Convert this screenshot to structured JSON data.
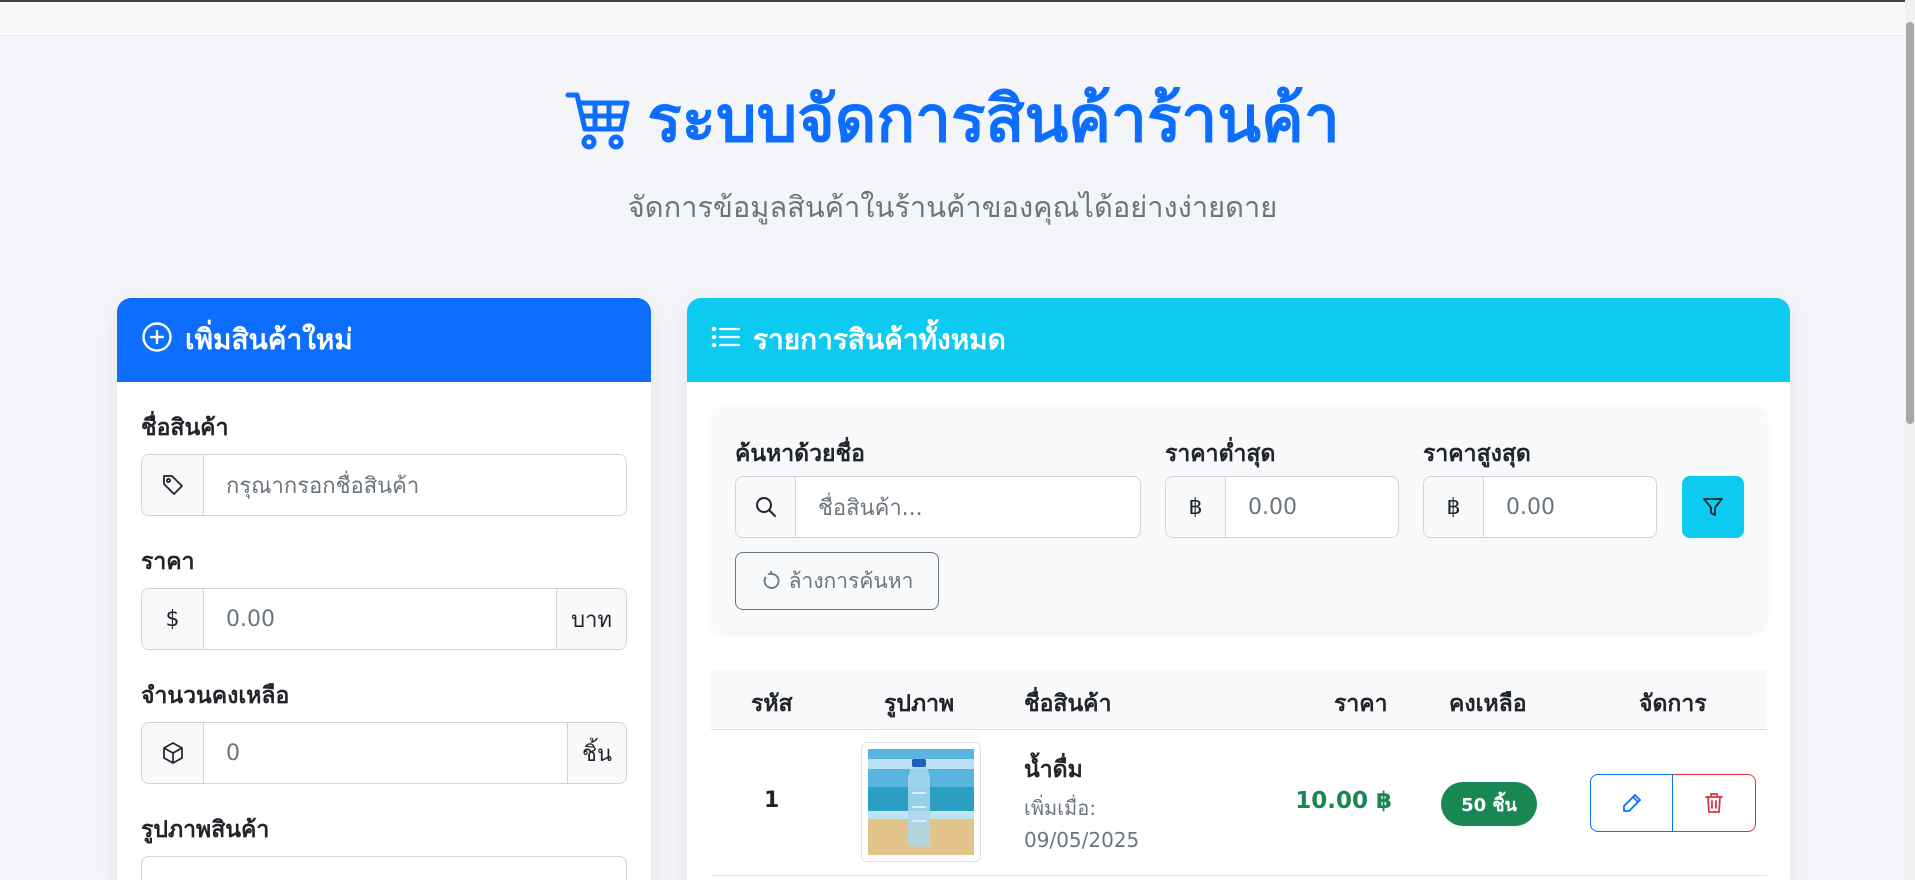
{
  "header": {
    "title": "ระบบจัดการสินค้าร้านค้า",
    "subtitle": "จัดการข้อมูลสินค้าในร้านค้าของคุณได้อย่างง่ายดาย"
  },
  "add_form": {
    "title": "เพิ่มสินค้าใหม่",
    "name_label": "ชื่อสินค้า",
    "name_placeholder": "กรุณากรอกชื่อสินค้า",
    "price_label": "ราคา",
    "price_prefix": "$",
    "price_placeholder": "0.00",
    "price_suffix": "บาท",
    "stock_label": "จำนวนคงเหลือ",
    "stock_placeholder": "0",
    "stock_suffix": "ชิ้น",
    "image_label": "รูปภาพสินค้า"
  },
  "list": {
    "title": "รายการสินค้าทั้งหมด",
    "search": {
      "name_label": "ค้นหาด้วยชื่อ",
      "name_placeholder": "ชื่อสินค้า...",
      "min_label": "ราคาต่ำสุด",
      "max_label": "ราคาสูงสุด",
      "currency": "฿",
      "min_placeholder": "0.00",
      "max_placeholder": "0.00",
      "reset_label": "ล้างการค้นหา"
    },
    "columns": [
      "รหัส",
      "รูปภาพ",
      "ชื่อสินค้า",
      "ราคา",
      "คงเหลือ",
      "จัดการ"
    ],
    "rows": [
      {
        "id": "1",
        "name": "น้ำดื่ม",
        "added_label": "เพิ่มเมื่อ:",
        "added_date": "09/05/2025",
        "price": "10.00 ฿",
        "stock": "50 ชิ้น"
      }
    ]
  },
  "colors": {
    "primary": "#0d6efd",
    "info": "#0dcaf0",
    "success": "#198754",
    "danger": "#dc3545"
  },
  "icons": [
    "cart-icon",
    "plus-circle-icon",
    "list-icon",
    "tag-icon",
    "box-icon",
    "search-icon",
    "filter-icon",
    "reset-icon",
    "edit-icon",
    "trash-icon"
  ]
}
